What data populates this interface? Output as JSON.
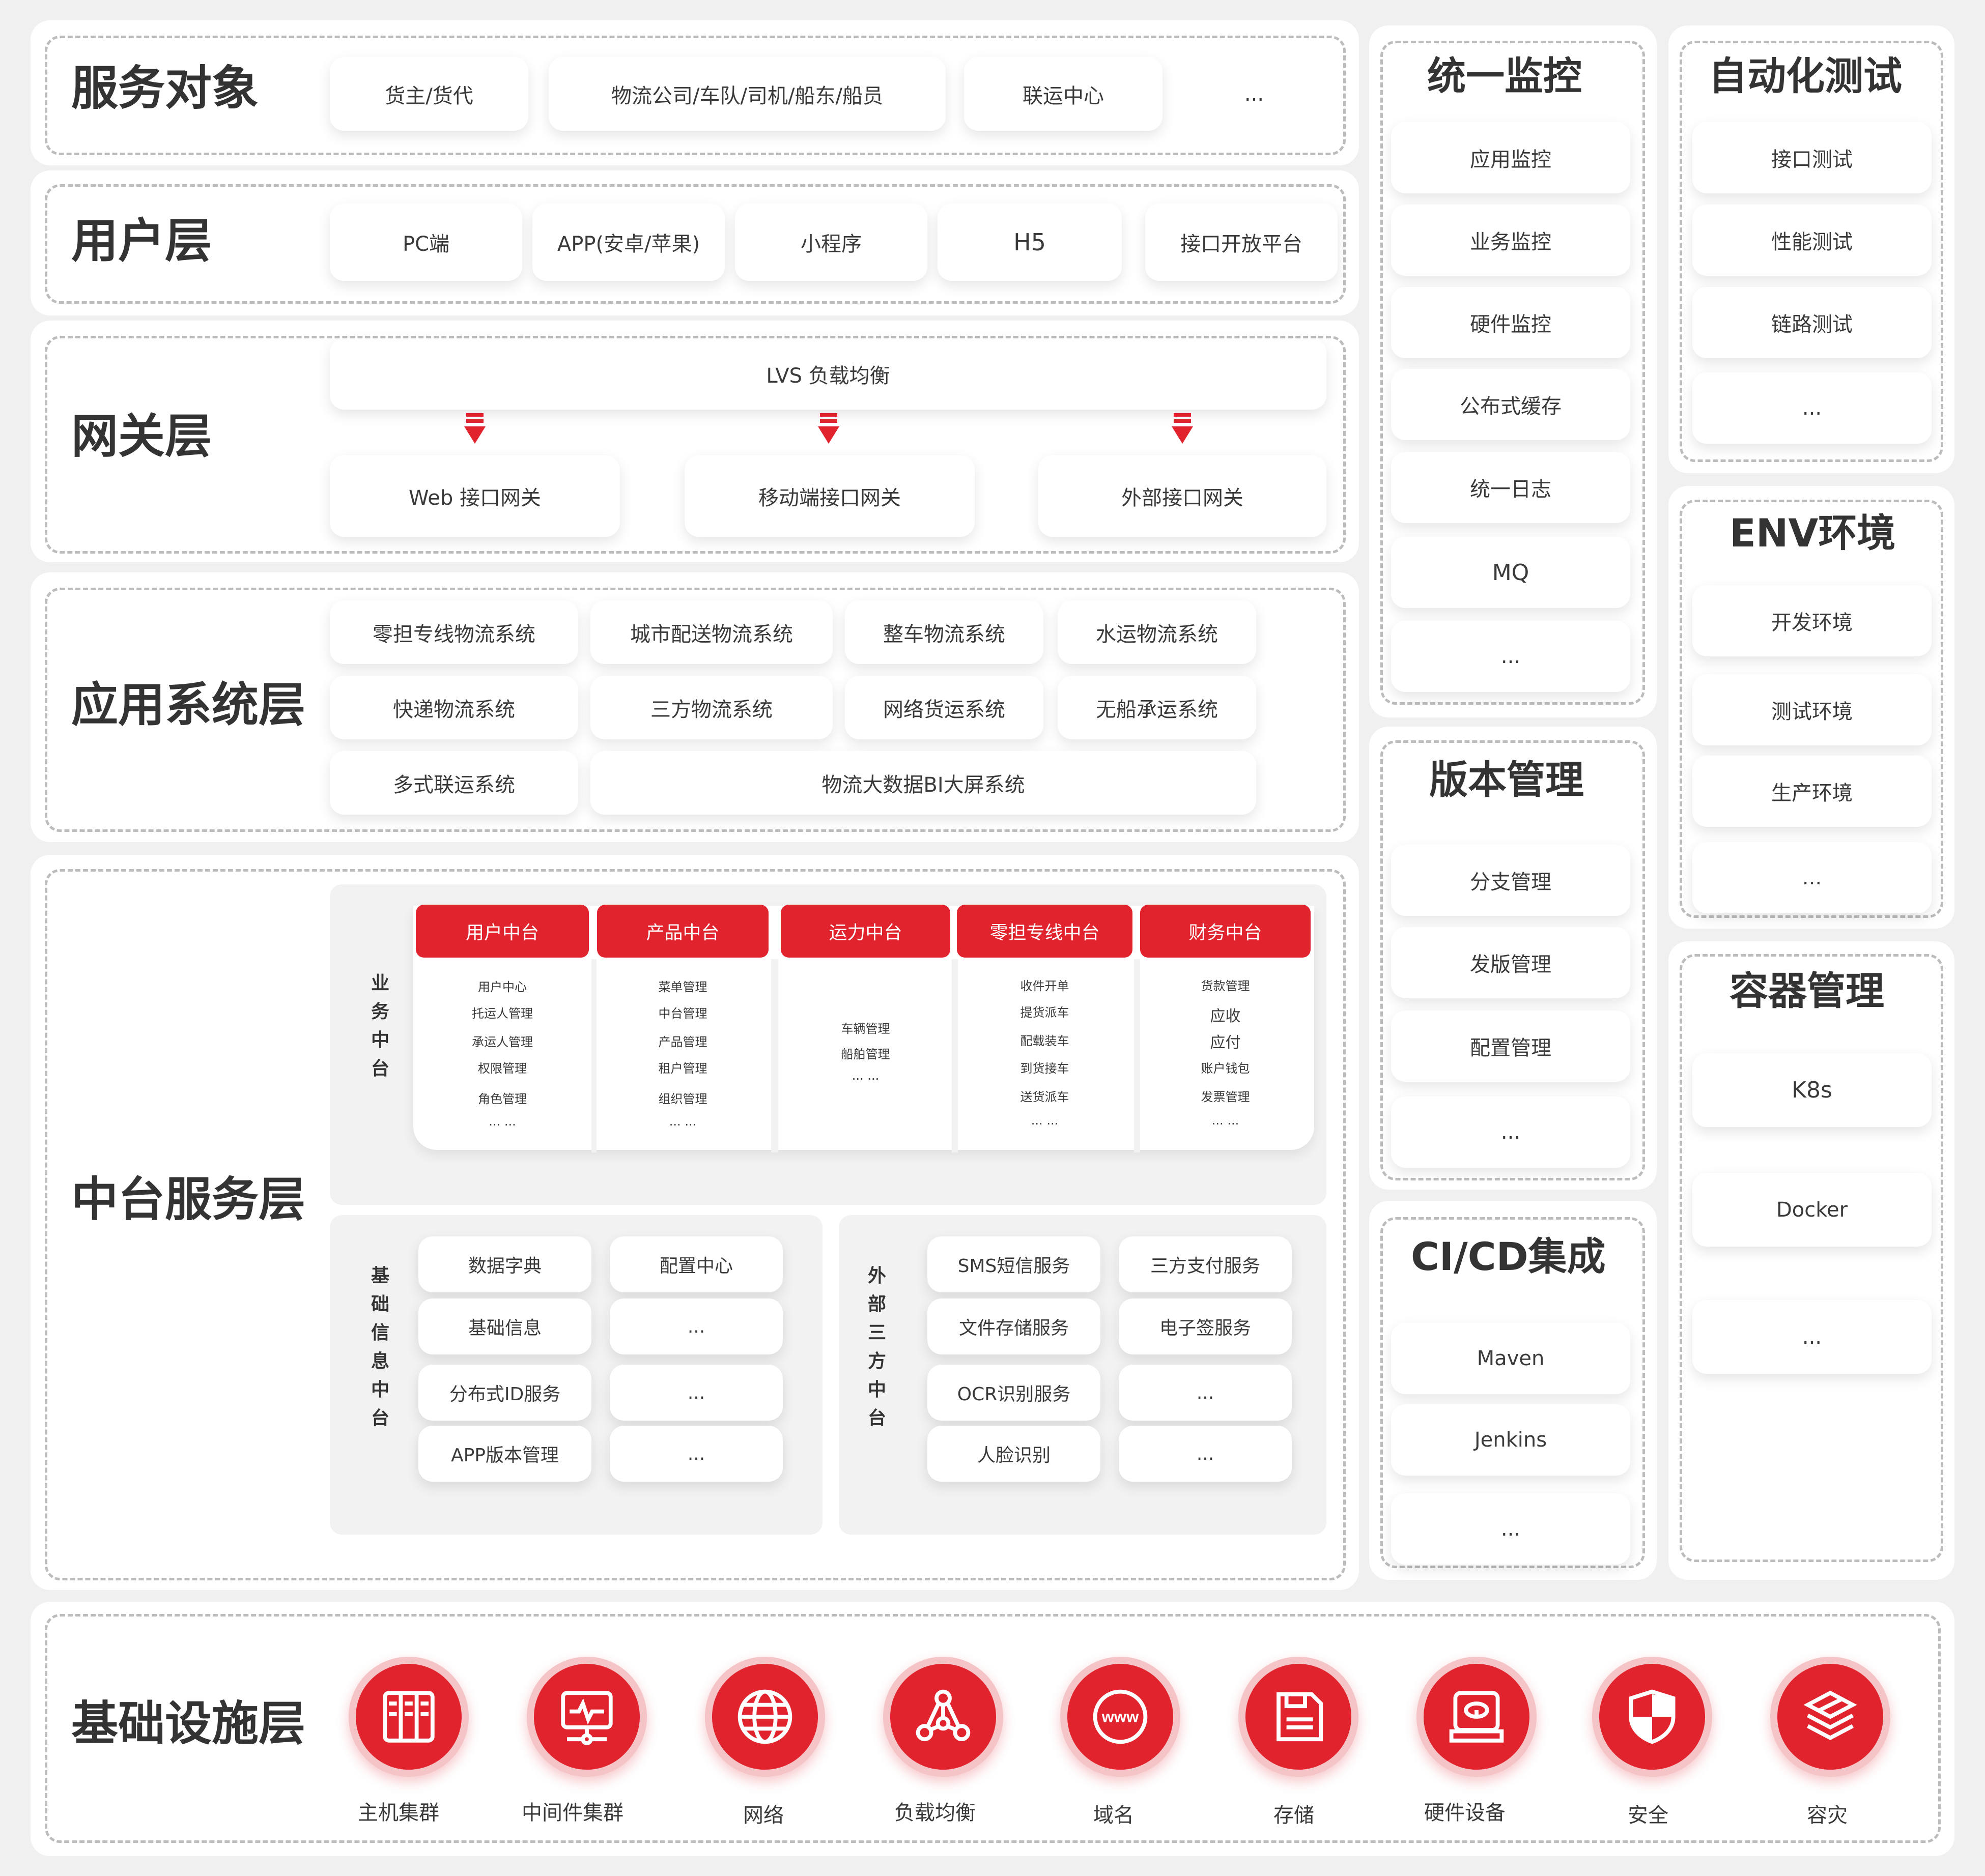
{
  "service_targets": {
    "title": "服务对象",
    "items": [
      "货主/货代",
      "物流公司/车队/司机/船东/船员",
      "联运中心",
      "..."
    ]
  },
  "user_layer": {
    "title": "用户层",
    "items": [
      "PC端",
      "APP(安卓/苹果)",
      "小程序",
      "H5",
      "接口开放平台"
    ]
  },
  "gateway_layer": {
    "title": "网关层",
    "lvs": "LVS 负载均衡",
    "gateways": [
      "Web 接口网关",
      "移动端接口网关",
      "外部接口网关"
    ]
  },
  "app_layer": {
    "title": "应用系统层",
    "row1": [
      "零担专线物流系统",
      "城市配送物流系统",
      "整车物流系统",
      "水运物流系统"
    ],
    "row2": [
      "快递物流系统",
      "三方物流系统",
      "网络货运系统",
      "无船承运系统"
    ],
    "row3": [
      "多式联运系统",
      "物流大数据BI大屏系统"
    ]
  },
  "middle_layer": {
    "title": "中台服务层",
    "business": {
      "label": "业务中台",
      "columns": [
        {
          "header": "用户中台",
          "items": [
            "用户中心",
            "托运人管理",
            "承运人管理",
            "权限管理",
            "角色管理",
            "... ..."
          ]
        },
        {
          "header": "产品中台",
          "items": [
            "菜单管理",
            "中台管理",
            "产品管理",
            "租户管理",
            "组织管理",
            "... ..."
          ]
        },
        {
          "header": "运力中台",
          "items": [
            "车辆管理",
            "船舶管理",
            "... ..."
          ]
        },
        {
          "header": "零担专线中台",
          "items": [
            "收件开单",
            "提货派车",
            "配载装车",
            "到货接车",
            "送货派车",
            "... ..."
          ]
        },
        {
          "header": "财务中台",
          "items": [
            "货款管理",
            "应收",
            "应付",
            "账户钱包",
            "发票管理",
            "... ..."
          ]
        }
      ]
    },
    "basic": {
      "label": "基础信息中台",
      "left": [
        "数据字典",
        "基础信息",
        "分布式ID服务",
        "APP版本管理"
      ],
      "right": [
        "配置中心",
        "...",
        "...",
        "..."
      ]
    },
    "external": {
      "label": "外部三方中台",
      "left": [
        "SMS短信服务",
        "文件存储服务",
        "OCR识别服务",
        "人脸识别"
      ],
      "right": [
        "三方支付服务",
        "电子签服务",
        "...",
        "..."
      ]
    }
  },
  "infra_layer": {
    "title": "基础设施层",
    "items": [
      {
        "label": "主机集群",
        "icon": "server-rack-icon"
      },
      {
        "label": "中间件集群",
        "icon": "monitor-node-icon"
      },
      {
        "label": "网络",
        "icon": "globe-icon"
      },
      {
        "label": "负载均衡",
        "icon": "network-nodes-icon"
      },
      {
        "label": "域名",
        "icon": "www-icon"
      },
      {
        "label": "存储",
        "icon": "floppy-disk-icon"
      },
      {
        "label": "硬件设备",
        "icon": "hard-drive-icon"
      },
      {
        "label": "安全",
        "icon": "shield-icon"
      },
      {
        "label": "容灾",
        "icon": "backup-layers-icon"
      }
    ],
    "accent": "#e1232e"
  },
  "monitoring": {
    "title": "统一监控",
    "items": [
      "应用监控",
      "业务监控",
      "硬件监控",
      "公布式缓存",
      "统一日志",
      "MQ",
      "..."
    ]
  },
  "version": {
    "title": "版本管理",
    "items": [
      "分支管理",
      "发版管理",
      "配置管理",
      "..."
    ]
  },
  "cicd": {
    "title": "CI/CD集成",
    "items": [
      "Maven",
      "Jenkins",
      "..."
    ]
  },
  "autotest": {
    "title": "自动化测试",
    "items": [
      "接口测试",
      "性能测试",
      "链路测试",
      "..."
    ]
  },
  "env": {
    "title": "ENV环境",
    "items": [
      "开发环境",
      "测试环境",
      "生产环境",
      "..."
    ]
  },
  "container": {
    "title": "容器管理",
    "items": [
      "K8s",
      "Docker",
      "..."
    ]
  }
}
